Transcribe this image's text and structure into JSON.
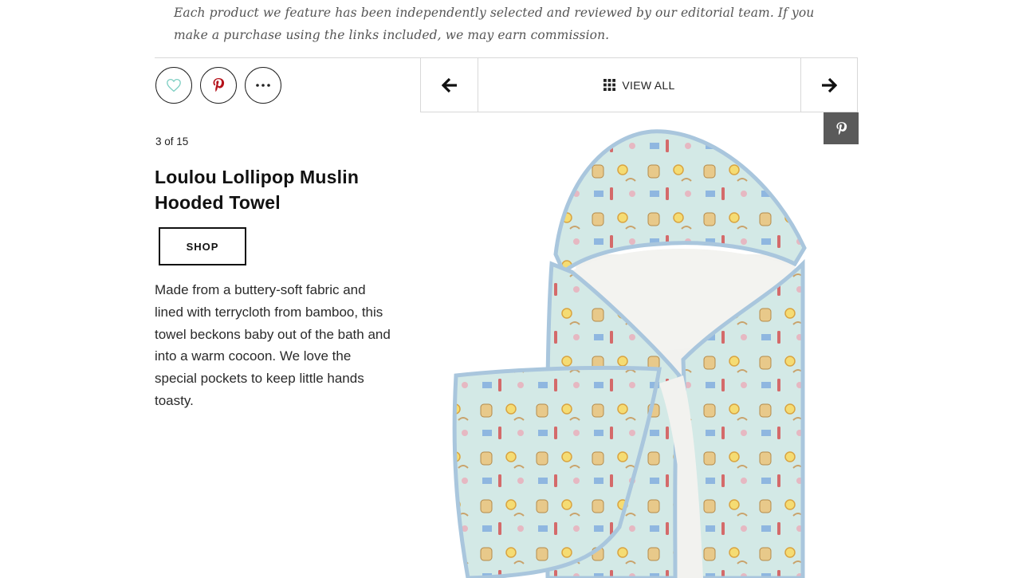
{
  "disclaimer": "Each product we feature has been independently selected and reviewed by our editorial team. If you make a purchase using the links included, we may earn commission.",
  "social": {
    "like_icon": "heart-outline-icon",
    "pin_icon": "pinterest-icon",
    "more_icon": "more-dots-icon"
  },
  "gallery_nav": {
    "prev_icon": "arrow-left-icon",
    "view_all_label": "VIEW ALL",
    "view_all_icon": "grid-icon",
    "next_icon": "arrow-right-icon"
  },
  "product": {
    "counter": "3 of 15",
    "title": "Loulou Lollipop Muslin Hooded Towel",
    "shop_label": "SHOP",
    "description": "Made from a buttery-soft fabric and lined with terrycloth from bamboo, this towel beckons baby out of the bath and into a warm cocoon. We love the special pockets to keep little hands toasty.",
    "image_pin_icon": "pinterest-icon"
  },
  "colors": {
    "heart": "#7fcfc3",
    "pinterest": "#b5121b",
    "towel_print": "#cfe6e4",
    "towel_trim": "#a9c6dd",
    "terry": "#f2f2ef",
    "pin_overlay_bg": "#5a5a5a"
  }
}
